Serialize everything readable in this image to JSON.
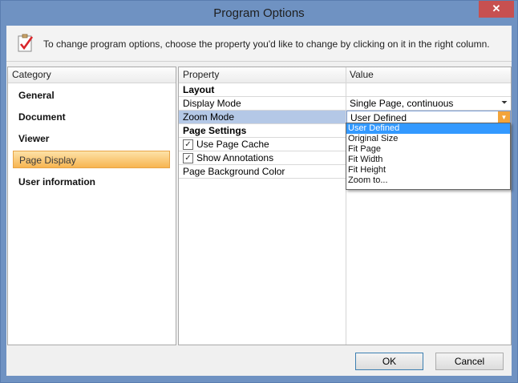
{
  "window": {
    "title": "Program Options",
    "close_glyph": "✕"
  },
  "info": {
    "icon": "checklist-icon",
    "text": "To change program options, choose the property you'd like to change by clicking on it in the right column."
  },
  "category_panel": {
    "header": "Category",
    "items": [
      {
        "label": "General",
        "selected": false
      },
      {
        "label": "Document",
        "selected": false
      },
      {
        "label": "Viewer",
        "selected": false
      },
      {
        "label": "Page Display",
        "selected": true
      },
      {
        "label": "User information",
        "selected": false
      }
    ]
  },
  "grid": {
    "col_property": "Property",
    "col_value": "Value",
    "layout_section": "Layout",
    "display_mode": {
      "label": "Display Mode",
      "value": "Single Page, continuous"
    },
    "zoom_mode": {
      "label": "Zoom Mode",
      "value": "User Defined"
    },
    "page_settings_section": "Page Settings",
    "use_page_cache": {
      "label": "Use Page Cache",
      "checked": true
    },
    "show_annotations": {
      "label": "Show Annotations",
      "checked": true
    },
    "page_background_color": {
      "label": "Page Background Color",
      "value": ""
    }
  },
  "zoom_dropdown": {
    "options": [
      "User Defined",
      "Original Size",
      "Fit Page",
      "Fit Width",
      "Fit Height",
      "Zoom to..."
    ],
    "highlighted": "User Defined"
  },
  "buttons": {
    "ok": "OK",
    "cancel": "Cancel"
  },
  "colors": {
    "frame": "#6f92c2",
    "selection_orange": "#f7b551",
    "highlight_blue": "#3399ff"
  }
}
